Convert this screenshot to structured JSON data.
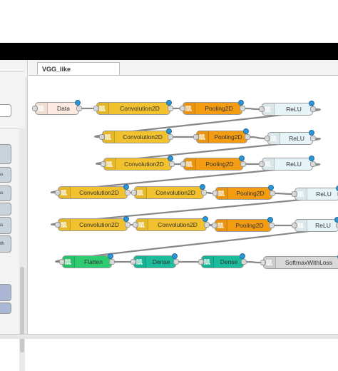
{
  "workspace": {
    "tab_label": "VGG_like"
  },
  "nodes": [
    {
      "label": "Data",
      "color": "#fde9e0"
    },
    {
      "label": "Convolution2D",
      "color": "#f2c12e"
    },
    {
      "label": "Pooling2D",
      "color": "#f39c12"
    },
    {
      "label": "ReLU",
      "color": "#e6f3f7"
    },
    {
      "label": "Convolution2D",
      "color": "#f2c12e"
    },
    {
      "label": "Pooling2D",
      "color": "#f39c12"
    },
    {
      "label": "ReLU",
      "color": "#e6f3f7"
    },
    {
      "label": "Convolution2D",
      "color": "#f2c12e"
    },
    {
      "label": "Pooling2D",
      "color": "#f39c12"
    },
    {
      "label": "ReLU",
      "color": "#e6f3f7"
    },
    {
      "label": "Convolution2D",
      "color": "#f2c12e"
    },
    {
      "label": "Convolution2D",
      "color": "#f2c12e"
    },
    {
      "label": "Pooling2D",
      "color": "#f39c12"
    },
    {
      "label": "ReLU",
      "color": "#e6f3f7"
    },
    {
      "label": "Convolution2D",
      "color": "#f2c12e"
    },
    {
      "label": "Convolution2D",
      "color": "#f2c12e"
    },
    {
      "label": "Pooling2D",
      "color": "#f39c12"
    },
    {
      "label": "ReLU",
      "color": "#e6f3f7"
    },
    {
      "label": "Flatten",
      "color": "#2ecc71"
    },
    {
      "label": "Dense",
      "color": "#1abc9c"
    },
    {
      "label": "Dense",
      "color": "#1abc9c"
    },
    {
      "label": "SoftmaxWithLoss",
      "color": "#d9d9d9"
    }
  ],
  "palette": {
    "items": [
      {
        "label": "",
        "color": "#ffffff"
      },
      {
        "label": "n",
        "color": "#c9d3dc"
      },
      {
        "label": "oss",
        "color": "#c9d3dc"
      },
      {
        "label": "oss",
        "color": "#c9d3dc"
      },
      {
        "label": "n",
        "color": "#c9d3dc"
      },
      {
        "label": "oss",
        "color": "#c9d3dc"
      },
      {
        "label": "with",
        "color": "#c9d3dc"
      },
      {
        "label": "",
        "color": "#aab8d6"
      },
      {
        "label": "",
        "color": "#aab8d6"
      }
    ]
  }
}
